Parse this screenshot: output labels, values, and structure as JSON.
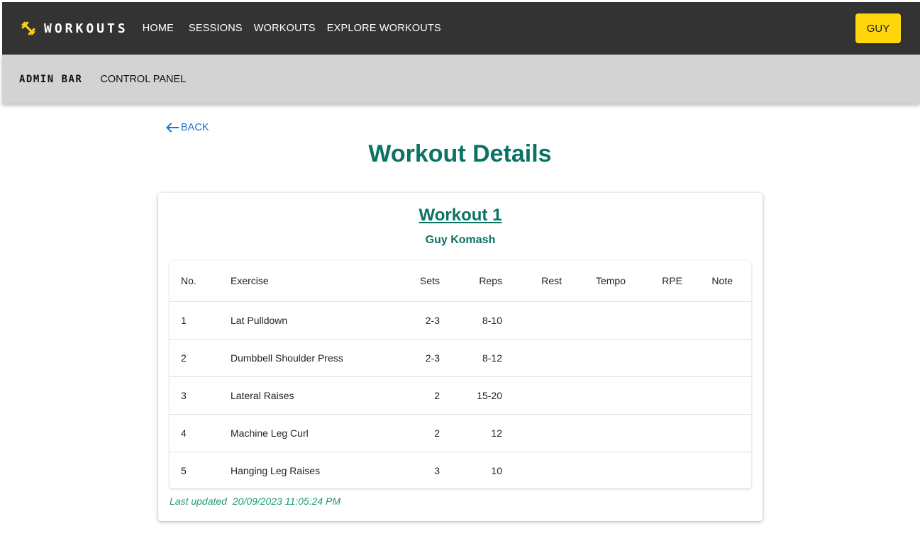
{
  "nav": {
    "brand": "WORKOUTS",
    "brand_icon": "dumbbell-icon",
    "items": [
      {
        "label": "HOME"
      },
      {
        "label": "SESSIONS"
      },
      {
        "label": "WORKOUTS"
      },
      {
        "label": "EXPLORE WORKOUTS"
      }
    ],
    "user_button": "GUY",
    "accent_color": "#ffd60a"
  },
  "admin_bar": {
    "title": "ADMIN BAR",
    "link": "CONTROL PANEL"
  },
  "back_label": "BACK",
  "page_title": "Workout Details",
  "workout": {
    "name": "Workout 1",
    "owner": "Guy Komash",
    "columns": [
      "No.",
      "Exercise",
      "Sets",
      "Reps",
      "Rest",
      "Tempo",
      "RPE",
      "Note"
    ],
    "rows": [
      {
        "no": "1",
        "exercise": "Lat Pulldown",
        "sets": "2-3",
        "reps": "8-10",
        "rest": "",
        "tempo": "",
        "rpe": "",
        "note": ""
      },
      {
        "no": "2",
        "exercise": "Dumbbell Shoulder Press",
        "sets": "2-3",
        "reps": "8-12",
        "rest": "",
        "tempo": "",
        "rpe": "",
        "note": ""
      },
      {
        "no": "3",
        "exercise": "Lateral Raises",
        "sets": "2",
        "reps": "15-20",
        "rest": "",
        "tempo": "",
        "rpe": "",
        "note": ""
      },
      {
        "no": "4",
        "exercise": "Machine Leg Curl",
        "sets": "2",
        "reps": "12",
        "rest": "",
        "tempo": "",
        "rpe": "",
        "note": ""
      },
      {
        "no": "5",
        "exercise": "Hanging Leg Raises",
        "sets": "3",
        "reps": "10",
        "rest": "",
        "tempo": "",
        "rpe": "",
        "note": ""
      }
    ],
    "last_updated_label": "Last updated",
    "last_updated_value": "20/09/2023 11:05:24 PM"
  },
  "colors": {
    "title_green": "#0a7363",
    "updated_green": "#1e9c6b",
    "link_blue": "#1976d2",
    "topbar": "#333333",
    "adminbar": "#d3d3d3"
  }
}
